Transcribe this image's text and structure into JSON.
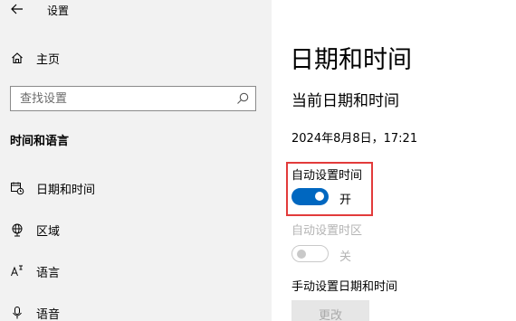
{
  "window": {
    "title": "设置"
  },
  "sidebar": {
    "home_label": "主页",
    "search_placeholder": "查找设置",
    "section_header": "时间和语言",
    "items": [
      {
        "icon": "calendar-clock-icon",
        "label": "日期和时间"
      },
      {
        "icon": "globe-icon",
        "label": "区域"
      },
      {
        "icon": "language-icon",
        "label": "语言"
      },
      {
        "icon": "microphone-icon",
        "label": "语音"
      }
    ]
  },
  "main": {
    "page_title": "日期和时间",
    "current_heading": "当前日期和时间",
    "current_datetime": "2024年8月8日，17:21",
    "auto_time": {
      "label": "自动设置时间",
      "state": "开",
      "on": true
    },
    "auto_timezone": {
      "label": "自动设置时区",
      "state": "关",
      "on": false,
      "disabled": true
    },
    "manual": {
      "label": "手动设置日期和时间",
      "button_label": "更改",
      "disabled": true
    }
  },
  "colors": {
    "accent": "#0067c0",
    "highlight_border": "#e23b3b",
    "sidebar_bg": "#f2f2f2",
    "disabled_text": "#b4b4b4"
  }
}
